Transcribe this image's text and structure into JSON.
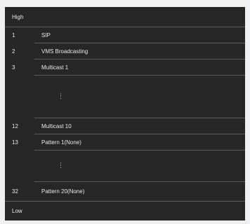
{
  "priority": {
    "high_label": "High",
    "low_label": "Low"
  },
  "items": [
    {
      "index": "1",
      "name": "SIP"
    },
    {
      "index": "2",
      "name": "VMS Broadcasting"
    },
    {
      "index": "3",
      "name": "Multicast 1"
    },
    {
      "index": "",
      "name": "⋮"
    },
    {
      "index": "12",
      "name": "Multicast 10"
    },
    {
      "index": "13",
      "name": "Pattern 1(None)"
    },
    {
      "index": "",
      "name": "⋮"
    },
    {
      "index": "32",
      "name": "Pattern 20(None)"
    }
  ]
}
